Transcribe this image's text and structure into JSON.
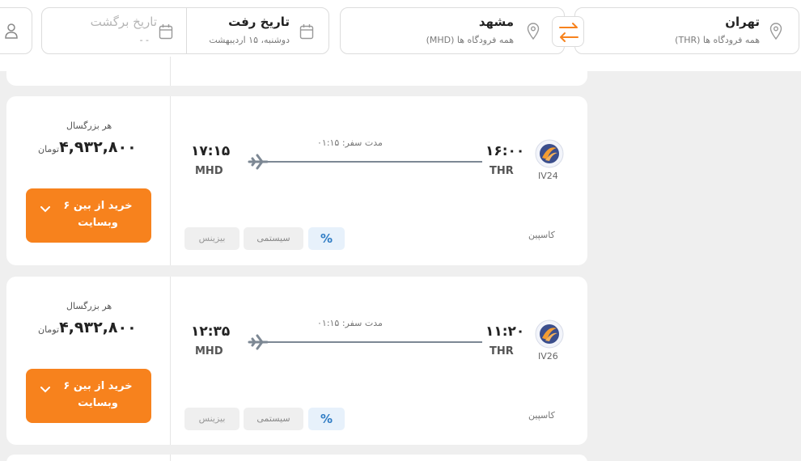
{
  "search": {
    "origin": {
      "city": "تهران",
      "airports": "همه فرودگاه ها (THR)"
    },
    "destination": {
      "city": "مشهد",
      "airports": "همه فرودگاه ها (MHD)"
    },
    "departure": {
      "label": "تاریخ رفت",
      "value": "دوشنبه، ۱۵ اردیبهشت"
    },
    "return": {
      "label": "تاریخ برگشت",
      "value": "- -"
    }
  },
  "flights": [
    {
      "flight_no": "IV24",
      "airline": "کاسپین",
      "dep_time": "۱۶:۰۰",
      "dep_airport": "THR",
      "arr_time": "۱۷:۱۵",
      "arr_airport": "MHD",
      "duration": "مدت سفر: ۰۱:۱۵",
      "price_label": "هر بزرگسال",
      "price": "۴,۹۳۲,۸۰۰",
      "currency": "تومان",
      "buy_label": "خرید از بین ۶\nوبسایت",
      "discount_symbol": "%",
      "class_system": "سیستمی",
      "class_business": "بیزینس"
    },
    {
      "flight_no": "IV26",
      "airline": "کاسپین",
      "dep_time": "۱۱:۲۰",
      "dep_airport": "THR",
      "arr_time": "۱۲:۳۵",
      "arr_airport": "MHD",
      "duration": "مدت سفر: ۰۱:۱۵",
      "price_label": "هر بزرگسال",
      "price": "۴,۹۳۲,۸۰۰",
      "currency": "تومان",
      "buy_label": "خرید از بین ۶\nوبسایت",
      "discount_symbol": "%",
      "class_system": "سیستمی",
      "class_business": "بیزینس"
    }
  ],
  "colors": {
    "accent": "#f7821d",
    "discount_chip": "#e7f1fb",
    "discount_text": "#2f7cc4"
  }
}
